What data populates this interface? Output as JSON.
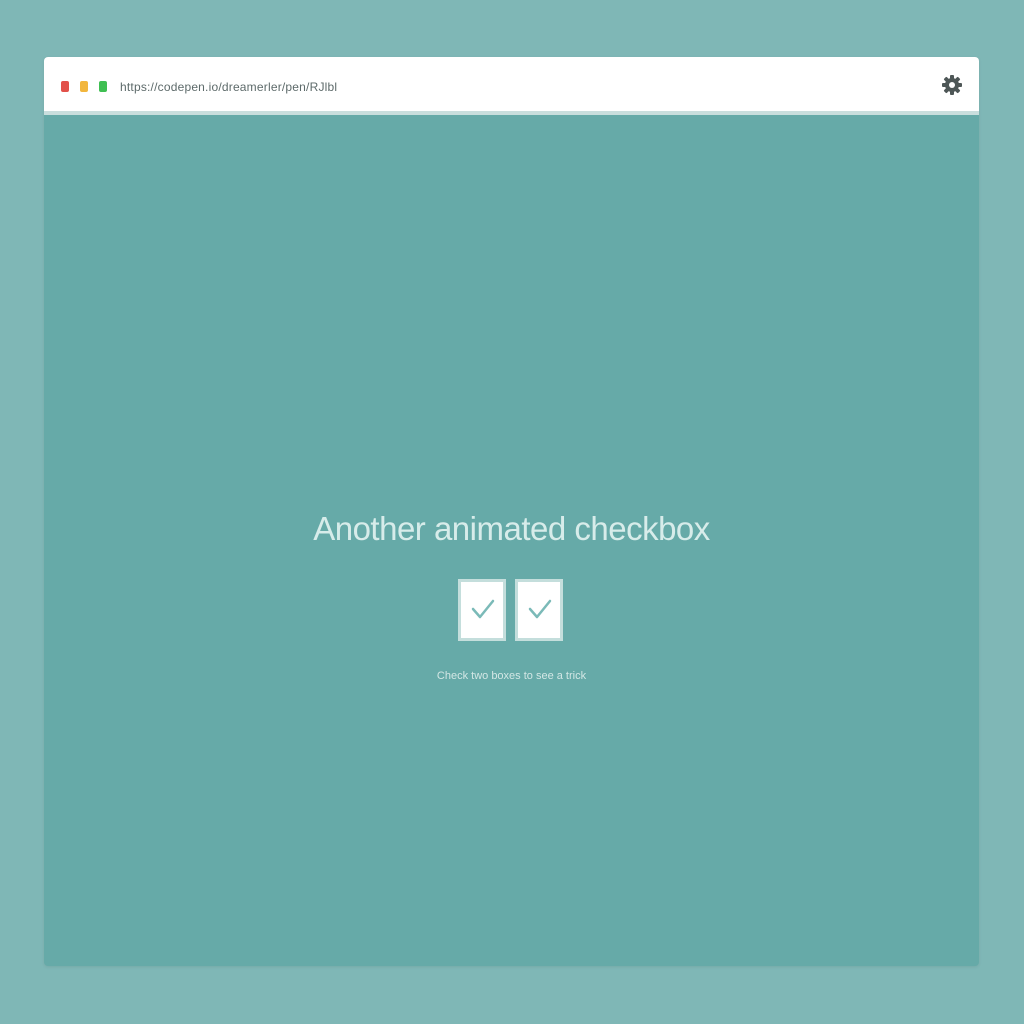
{
  "browser": {
    "url": "https://codepen.io/dreamerler/pen/RJlbl"
  },
  "icons": {
    "settings": "gear-icon",
    "check": "checkmark-icon"
  },
  "colors": {
    "page_bg": "#7fb7b6",
    "content_bg": "#66aaa8",
    "toolbar_bg": "#ffffff",
    "close": "#e2514a",
    "minimize": "#f2b63d",
    "maximize": "#3fbf52",
    "check_stroke": "#7bbab8"
  },
  "main": {
    "title": "Another animated checkbox",
    "checkboxes": [
      {
        "checked": true
      },
      {
        "checked": true
      }
    ],
    "hint": "Check two boxes to see a trick"
  }
}
